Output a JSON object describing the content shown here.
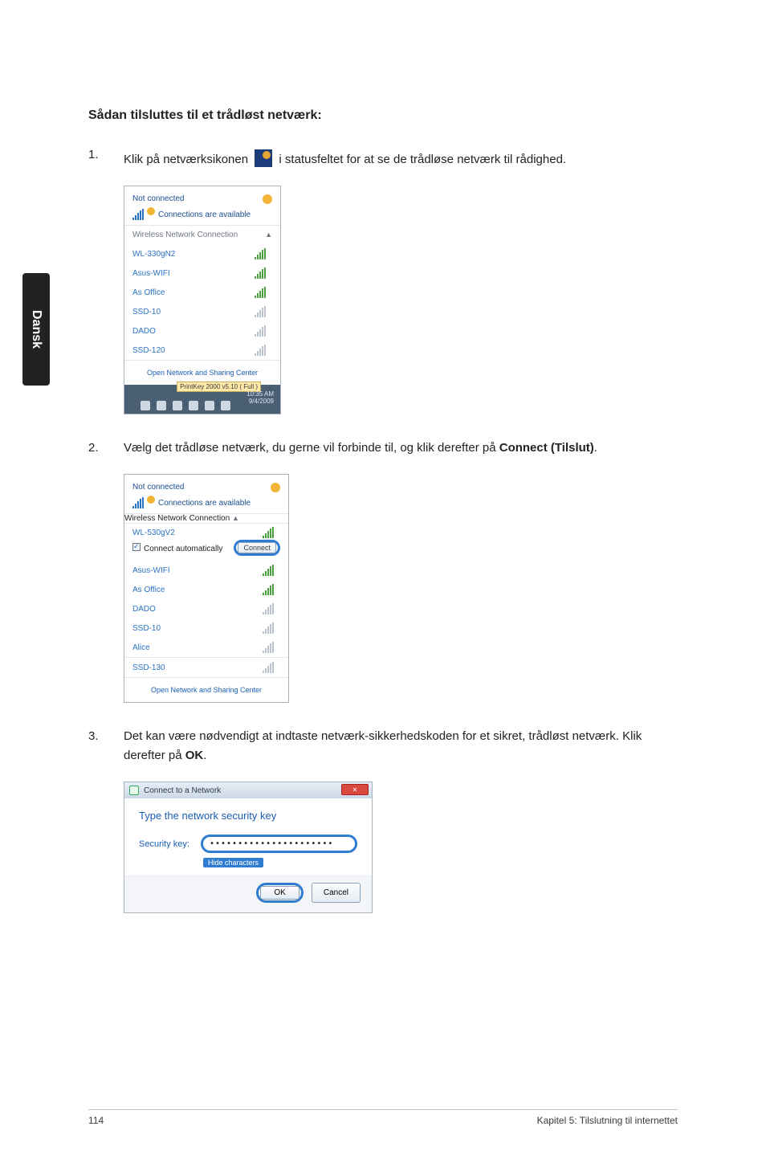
{
  "side_tab": "Dansk",
  "heading": "Sådan tilsluttes til et trådløst netværk:",
  "steps": {
    "s1_num": "1.",
    "s1_a": "Klik på netværksikonen ",
    "s1_b": " i statusfeltet for at se de trådløse netværk til rådighed.",
    "s2_num": "2.",
    "s2_a": "Vælg det trådløse netværk, du gerne vil forbinde til, og klik derefter på ",
    "s2_bold": "Connect (Tilslut)",
    "s2_b": ".",
    "s3_num": "3.",
    "s3_a": "Det kan være nødvendigt at indtaste netværk-sikkerhedskoden for et sikret, trådløst netværk. Klik derefter på ",
    "s3_bold": "OK",
    "s3_b": "."
  },
  "popup1": {
    "not_connected": "Not connected",
    "avail": "Connections are available",
    "section": "Wireless Network Connection",
    "up_caret": "▲",
    "networks": [
      {
        "name": "WL-330gN2"
      },
      {
        "name": "Asus-WIFI"
      },
      {
        "name": "As Office"
      },
      {
        "name": "SSD-10"
      },
      {
        "name": "DADO"
      },
      {
        "name": "SSD-120"
      }
    ],
    "open_link": "Open Network and Sharing Center",
    "tray_tip": "PrintKey 2000 v5.10 ( Full )",
    "clock1": "10:35 AM",
    "clock2": "9/4/2009"
  },
  "popup2": {
    "not_connected": "Not connected",
    "avail": "Connections are available",
    "section": "Wireless Network Connection",
    "up_caret": "▲",
    "selected": "WL-530gV2",
    "cb_label": "Connect automatically",
    "connect_btn": "Connect",
    "networks": [
      {
        "name": "Asus-WIFI"
      },
      {
        "name": "As Office"
      },
      {
        "name": "DADO"
      },
      {
        "name": "SSD-10"
      },
      {
        "name": "Alice"
      },
      {
        "name": "SSD-130"
      }
    ],
    "open_link": "Open Network and Sharing Center"
  },
  "dialog": {
    "title": "Connect to a Network",
    "prompt": "Type the network security key",
    "key_label": "Security key:",
    "key_value": "••••••••••••••••••••••",
    "hide": "Hide characters",
    "ok": "OK",
    "cancel": "Cancel"
  },
  "footer": {
    "page": "114",
    "chapter": "Kapitel 5: Tilslutning til internettet"
  }
}
